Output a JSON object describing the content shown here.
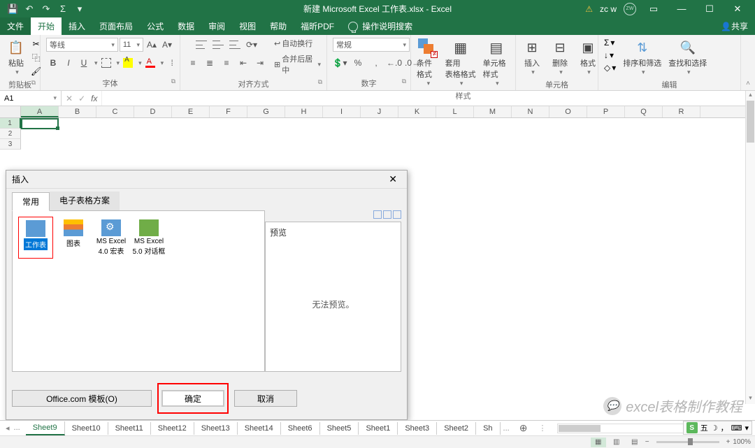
{
  "titlebar": {
    "filename": "新建 Microsoft Excel 工作表.xlsx - Excel",
    "user": "zc w",
    "user_initials": "ZW",
    "qat": {
      "save": "💾",
      "undo": "↶",
      "redo": "↷",
      "autosum": "Σ"
    }
  },
  "tabs": {
    "file": "文件",
    "home": "开始",
    "insert": "插入",
    "layout": "页面布局",
    "formulas": "公式",
    "data": "数据",
    "review": "审阅",
    "view": "视图",
    "help": "帮助",
    "foxit": "福昕PDF",
    "tell": "操作说明搜索",
    "share": "共享"
  },
  "ribbon": {
    "clipboard": {
      "paste": "粘贴",
      "label": "剪贴板"
    },
    "font": {
      "label": "字体",
      "family": "等线",
      "size": "11",
      "bold": "B",
      "italic": "I",
      "underline": "U"
    },
    "alignment": {
      "label": "对齐方式",
      "wrap": "自动换行",
      "merge": "合并后居中"
    },
    "number": {
      "label": "数字",
      "format": "常规"
    },
    "styles": {
      "label": "样式",
      "cf": "条件格式",
      "tbl": "套用\n表格格式",
      "cell": "单元格样式"
    },
    "cells": {
      "label": "单元格",
      "insert": "插入",
      "delete": "删除",
      "format": "格式"
    },
    "editing": {
      "label": "编辑",
      "sort": "排序和筛选",
      "find": "查找和选择",
      "sum": "Σ",
      "fill": "↓",
      "clear": "◇"
    }
  },
  "formula_bar": {
    "ref": "A1",
    "cancel": "✕",
    "confirm": "✓",
    "fx": "fx"
  },
  "grid": {
    "columns": [
      "A",
      "B",
      "C",
      "D",
      "E",
      "F",
      "G",
      "H",
      "I",
      "J",
      "K",
      "L",
      "M",
      "N",
      "O",
      "P",
      "Q",
      "R"
    ],
    "rows": [
      "1",
      "2",
      "3"
    ],
    "active": "A1"
  },
  "dialog": {
    "title": "插入",
    "tabs": {
      "general": "常用",
      "sheets": "电子表格方案"
    },
    "items": {
      "worksheet": "工作表",
      "chart": "图表",
      "macro": "MS Excel\n4.0 宏表",
      "dlg": "MS Excel\n5.0 对话框"
    },
    "preview_label": "预览",
    "preview_msg": "无法预览。",
    "office_btn": "Office.com 模板(O)",
    "ok": "确定",
    "cancel": "取消"
  },
  "sheets": {
    "list": [
      "Sheet9",
      "Sheet10",
      "Sheet11",
      "Sheet12",
      "Sheet13",
      "Sheet14",
      "Sheet6",
      "Sheet5",
      "Sheet1",
      "Sheet3",
      "Sheet2",
      "Sh"
    ],
    "more": "...",
    "active": "Sheet9",
    "new": "⊕"
  },
  "statusbar": {
    "zoom": "100%"
  },
  "watermark": {
    "text": "excel表格制作教程"
  },
  "ime": {
    "name": "五"
  }
}
